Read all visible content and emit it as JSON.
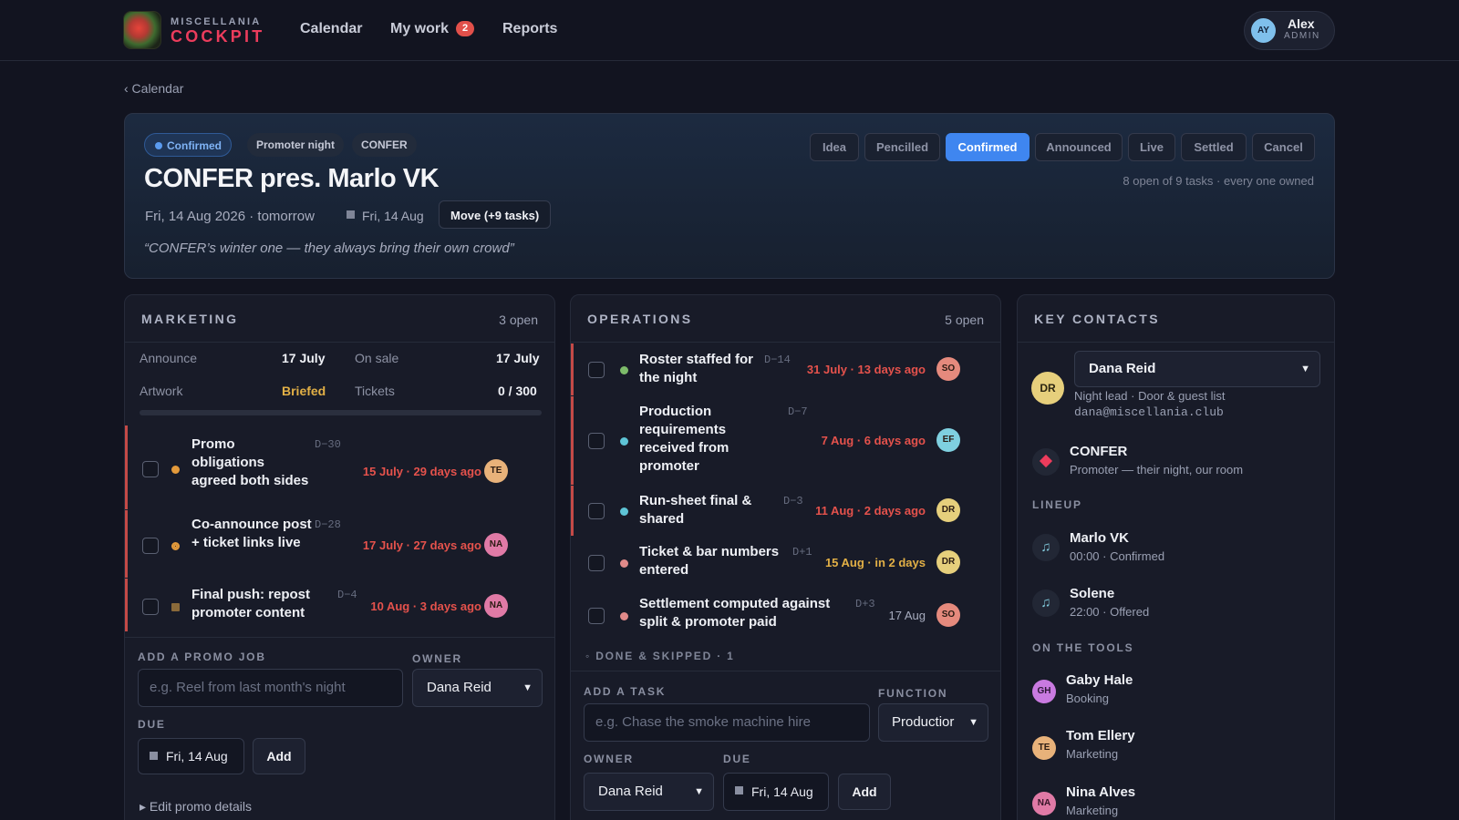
{
  "app": {
    "logo_top": "MISCELLANIA",
    "logo_bottom": "COCKPIT",
    "nav": [
      {
        "label": "Calendar"
      },
      {
        "label": "My work",
        "badge": "2"
      },
      {
        "label": "Reports"
      }
    ],
    "user": {
      "initials": "AY",
      "name": "Alex",
      "role": "ADMIN"
    }
  },
  "breadcrumb": "‹ Calendar",
  "event": {
    "status_chip": "Confirmed",
    "type_chip": "Promoter night",
    "promoter_chip": "CONFER",
    "title": "CONFER pres. Marlo VK",
    "date_line": "Fri, 14 Aug 2026 · tomorrow",
    "date_short": "Fri, 14 Aug",
    "move_label": "Move (+9 tasks)",
    "quote": "“CONFER’s winter one — they always bring their own crowd”",
    "status_options": [
      "Idea",
      "Pencilled",
      "Confirmed",
      "Announced",
      "Live",
      "Settled",
      "Cancel"
    ],
    "status_selected": "Confirmed",
    "task_summary": "8 open of 9 tasks · every one owned"
  },
  "marketing": {
    "title": "MARKETING",
    "open": "3 open",
    "announce_label": "Announce",
    "announce_value": "17 July",
    "onsale_label": "On sale",
    "onsale_value": "17 July",
    "artwork_label": "Artwork",
    "artwork_value": "Briefed",
    "tickets_label": "Tickets",
    "tickets_value": "0 / 300",
    "tickets_sold_fraction": 0,
    "tasks": [
      {
        "name": "Promo obligations agreed both sides",
        "code": "D−30",
        "due": "15 July · 29 days ago",
        "owner": "TE",
        "dot": "#e39a3b",
        "dot_shape": "circle"
      },
      {
        "name": "Co-announce post + ticket links live",
        "code": "D−28",
        "due": "17 July · 27 days ago",
        "owner": "NA",
        "dot": "#e39a3b",
        "dot_shape": "half"
      },
      {
        "name": "Final push: repost promoter content",
        "code": "D−4",
        "due": "10 Aug · 3 days ago",
        "owner": "NA",
        "dot": "#8a6a3a",
        "dot_shape": "square"
      }
    ],
    "add_label": "ADD A PROMO JOB",
    "add_placeholder": "e.g. Reel from last month's night",
    "owner_label": "OWNER",
    "owner_value": "Dana Reid",
    "due_label": "DUE",
    "due_value": "Fri, 14 Aug",
    "add_button": "Add",
    "edit_details": "▸ Edit promo details"
  },
  "operations": {
    "title": "OPERATIONS",
    "open": "5 open",
    "tasks": [
      {
        "name": "Roster staffed for the night",
        "code": "D−14",
        "due": "31 July · 13 days ago",
        "owner": "SO",
        "dot": "#7dbb6a",
        "overdue": true
      },
      {
        "name": "Production requirements received from promoter",
        "code": "D−7",
        "due": "7 Aug · 6 days ago",
        "owner": "EF",
        "dot": "#5ec4d6",
        "overdue": true
      },
      {
        "name": "Run-sheet final & shared",
        "code": "D−3",
        "due": "11 Aug · 2 days ago",
        "owner": "DR",
        "dot": "#5ec4d6",
        "overdue": true
      },
      {
        "name": "Ticket & bar numbers entered",
        "code": "D+1",
        "due": "15 Aug · in 2 days",
        "owner": "DR",
        "dot": "#e08a8a",
        "overdue": false
      },
      {
        "name": "Settlement computed against split & promoter paid",
        "code": "D+3",
        "due": "17 Aug",
        "owner": "SO",
        "dot": "#e08a8a",
        "overdue": false
      }
    ],
    "done_label": "◦ DONE & SKIPPED · 1",
    "add_label": "ADD A TASK",
    "add_placeholder": "e.g. Chase the smoke machine hire",
    "function_label": "FUNCTION",
    "function_value": "Productior",
    "owner_label": "OWNER",
    "owner_value": "Dana Reid",
    "due_label": "DUE",
    "due_value": "Fri, 14 Aug",
    "add_button": "Add"
  },
  "contacts": {
    "title": "KEY CONTACTS",
    "lead": {
      "initials": "DR",
      "select": "Dana Reid",
      "role": "Night lead · Door & guest list",
      "email": "dana@miscellania.club"
    },
    "promoter": {
      "name": "CONFER",
      "role": "Promoter — their night, our room"
    },
    "lineup_label": "LINEUP",
    "lineup": [
      {
        "name": "Marlo VK",
        "detail": "00:00 · Confirmed"
      },
      {
        "name": "Solene",
        "detail": "22:00 · Offered"
      }
    ],
    "tools_label": "ON THE TOOLS",
    "tools": [
      {
        "initials": "GH",
        "name": "Gaby Hale",
        "role": "Booking",
        "color": "#c97ae0"
      },
      {
        "initials": "TE",
        "name": "Tom Ellery",
        "role": "Marketing",
        "color": "#e8b27a"
      },
      {
        "initials": "NA",
        "name": "Nina Alves",
        "role": "Marketing",
        "color": "#e07aa6"
      }
    ]
  },
  "colors": {
    "accent": "#3f86f0",
    "overdue": "#e5524c",
    "upcoming": "#e2b046",
    "brand": "#ec3c5c",
    "owner_TE": "#e8b27a",
    "owner_NA": "#e07aa6",
    "owner_SO": "#e58a7d",
    "owner_EF": "#7fd0e0",
    "owner_DR": "#e6cf7c"
  }
}
